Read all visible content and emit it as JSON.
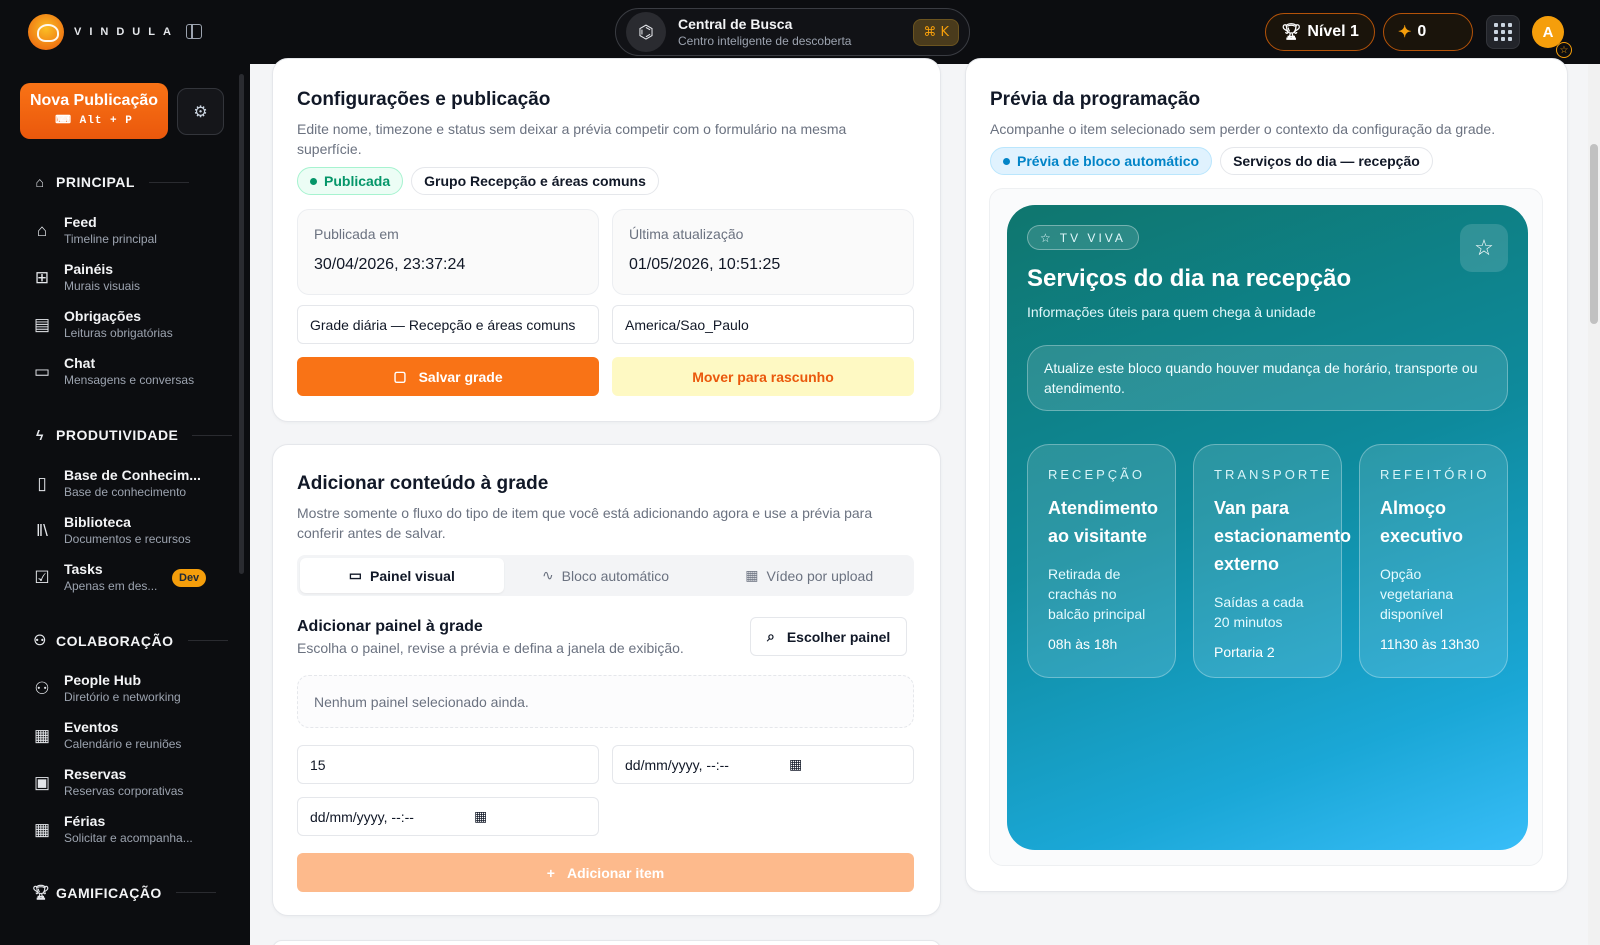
{
  "brand": {
    "name": "VINDULA"
  },
  "search": {
    "title": "Central de Busca",
    "subtitle": "Centro inteligente de descoberta",
    "shortcut": "⌘ K"
  },
  "topbar": {
    "level": "Nível 1",
    "points": "0",
    "avatar_letter": "A"
  },
  "sidebar": {
    "new_post": {
      "label": "Nova Publicação",
      "shortcut": "Alt + P"
    },
    "sections": [
      {
        "title": "PRINCIPAL",
        "items": [
          {
            "label": "Feed",
            "sub": "Timeline principal"
          },
          {
            "label": "Painéis",
            "sub": "Murais visuais"
          },
          {
            "label": "Obrigações",
            "sub": "Leituras obrigatórias"
          },
          {
            "label": "Chat",
            "sub": "Mensagens e conversas"
          }
        ]
      },
      {
        "title": "PRODUTIVIDADE",
        "items": [
          {
            "label": "Base de Conhecim...",
            "sub": "Base de conhecimento"
          },
          {
            "label": "Biblioteca",
            "sub": "Documentos e recursos"
          },
          {
            "label": "Tasks",
            "sub": "Apenas em des...",
            "badge": "Dev"
          }
        ]
      },
      {
        "title": "COLABORAÇÃO",
        "items": [
          {
            "label": "People Hub",
            "sub": "Diretório e networking"
          },
          {
            "label": "Eventos",
            "sub": "Calendário e reuniões"
          },
          {
            "label": "Reservas",
            "sub": "Reservas corporativas"
          },
          {
            "label": "Férias",
            "sub": "Solicitar e acompanha..."
          }
        ]
      },
      {
        "title": "GAMIFICAÇÃO",
        "items": []
      }
    ]
  },
  "config": {
    "title": "Configurações e publicação",
    "desc": "Edite nome, timezone e status sem deixar a prévia competir com o formulário na mesma superfície.",
    "status": "Publicada",
    "group": "Grupo Recepção e áreas comuns",
    "published_label": "Publicada em",
    "published_value": "30/04/2026, 23:37:24",
    "updated_label": "Última atualização",
    "updated_value": "01/05/2026, 10:51:25",
    "name_value": "Grade diária — Recepção e áreas comuns",
    "timezone_value": "America/Sao_Paulo",
    "save_label": "Salvar grade",
    "draft_label": "Mover para rascunho"
  },
  "add": {
    "title": "Adicionar conteúdo à grade",
    "desc": "Mostre somente o fluxo do tipo de item que você está adicionando agora e use a prévia para conferir antes de salvar.",
    "tabs": [
      "Painel visual",
      "Bloco automático",
      "Vídeo por upload"
    ],
    "panel_title": "Adicionar painel à grade",
    "panel_desc": "Escolha o painel, revise a prévia e defina a janela de exibição.",
    "choose_label": "Escolher painel",
    "empty_text": "Nenhum painel selecionado ainda.",
    "duration_value": "15",
    "start_placeholder": "dd/mm/yyyy, --:--",
    "end_placeholder": "dd/mm/yyyy, --:--",
    "add_label": "Adicionar item"
  },
  "preview": {
    "title": "Prévia da programação",
    "desc": "Acompanhe o item selecionado sem perder o contexto da configuração da grade.",
    "pill_active": "Prévia de bloco automático",
    "pill_name": "Serviços do dia — recepção",
    "tv": {
      "tag": "TV VIVA",
      "title": "Serviços do dia na recepção",
      "subtitle": "Informações úteis para quem chega à unidade",
      "note": "Atualize este bloco quando houver mudança de horário, transporte ou atendimento.",
      "cards": [
        {
          "category": "RECEPÇÃO",
          "title": "Atendimento ao visitante",
          "desc": "Retirada de crachás no balcão principal",
          "time": "08h às 18h"
        },
        {
          "category": "TRANSPORTE",
          "title": "Van para estacionamento externo",
          "desc": "Saídas a cada 20 minutos",
          "time": "Portaria 2"
        },
        {
          "category": "REFEITÓRIO",
          "title": "Almoço executivo",
          "desc": "Opção vegetariana disponível",
          "time": "11h30 às 13h30"
        }
      ]
    }
  },
  "colors": {
    "accent": "#f97316",
    "success": "#059669",
    "info": "#0284c7",
    "dark": "#0c0d10"
  }
}
